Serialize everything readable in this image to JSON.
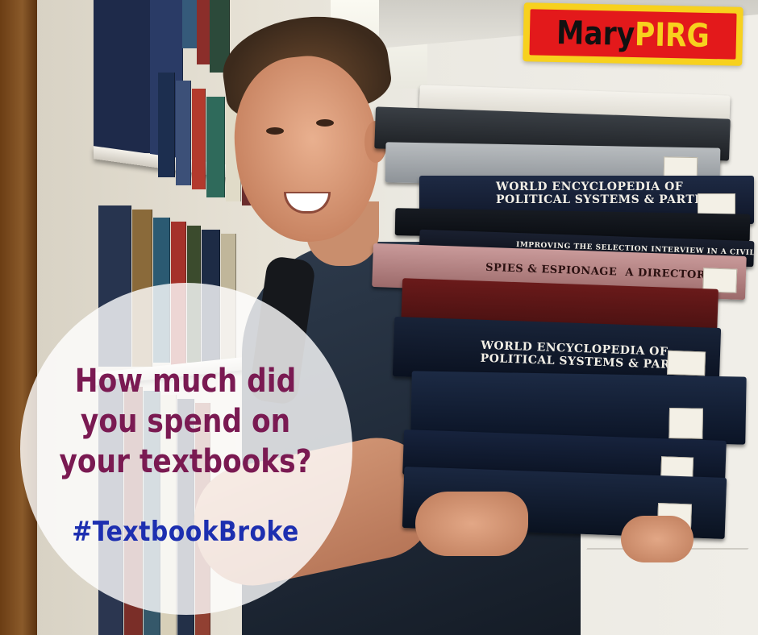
{
  "overlay": {
    "question_lines": [
      "How much did",
      "you spend on",
      "your textbooks?"
    ],
    "hashtag": "#TextbookBroke"
  },
  "logo": {
    "part1": "Mary",
    "part2": "PIRG"
  },
  "colors": {
    "question": "#7a1a52",
    "hashtag": "#1d2fb0",
    "logo_bg": "#e3191b",
    "logo_border": "#f7d11e",
    "circle": "rgba(255,255,255,0.80)"
  }
}
